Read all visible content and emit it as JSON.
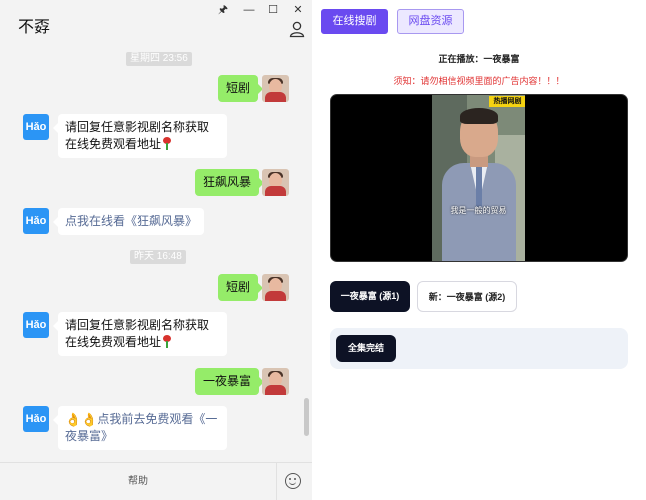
{
  "chat": {
    "title": "不孬",
    "window_controls": [
      "🖈",
      "—",
      "☐",
      "✕"
    ],
    "time_tags": [
      "星期四 23:56",
      "昨天 16:48"
    ],
    "bot_avatar_text": "Hǎo",
    "messages": {
      "m1": "短剧",
      "m2": "请回复任意影视剧名称获取在线免费观看地址",
      "m3": "狂飙风暴",
      "m4": "点我在线看《狂飙风暴》",
      "m5": "短剧",
      "m6": "请回复任意影视剧名称获取在线免费观看地址",
      "m7": "一夜暴富",
      "m8": "点我前去免费观看《一夜暴富》",
      "m8_hands": "👌👌"
    },
    "footer": {
      "help_label": "帮助"
    }
  },
  "player": {
    "tabs": {
      "online": "在线搜剧",
      "disk": "网盘资源"
    },
    "now_playing": "正在播放：一夜暴富",
    "notice": "须知：请勿相信视频里面的广告内容！！！",
    "video": {
      "badge": "热播网剧",
      "subtitle": "我是一般的贸易"
    },
    "sources": {
      "source1": "一夜暴富 (源1)",
      "source2": "新：一夜暴富 (源2)"
    },
    "episode_button": "全集完结"
  }
}
